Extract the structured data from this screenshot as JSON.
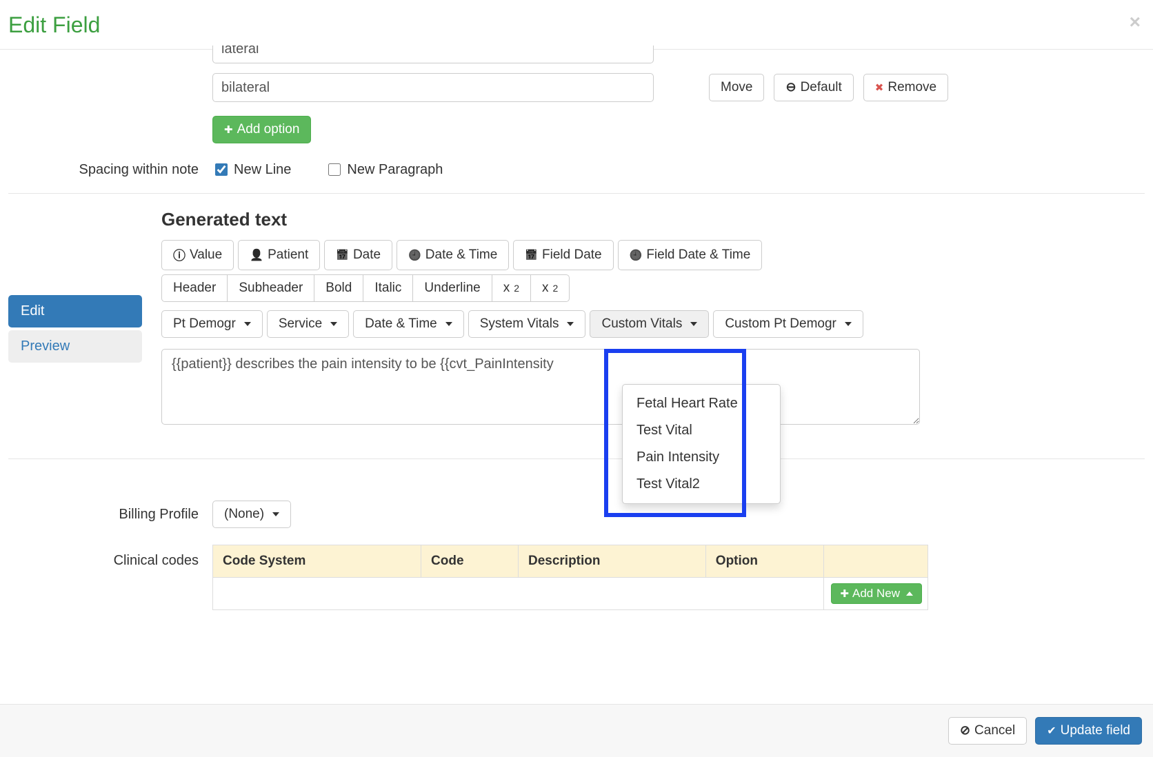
{
  "header": {
    "title": "Edit Field"
  },
  "options": {
    "row0_value": "lateral",
    "row1_value": "bilateral",
    "move_label": "Move",
    "default_label": "Default",
    "remove_label": "Remove",
    "add_option_label": "Add option"
  },
  "spacing": {
    "label": "Spacing within note",
    "newline_label": "New Line",
    "newparagraph_label": "New Paragraph",
    "newline_checked": true,
    "newparagraph_checked": false
  },
  "tabs": {
    "edit": "Edit",
    "preview": "Preview"
  },
  "generated": {
    "title": "Generated text",
    "toolbar": {
      "value": "Value",
      "patient": "Patient",
      "date": "Date",
      "datetime": "Date & Time",
      "fielddate": "Field Date",
      "fielddatetime": "Field Date & Time",
      "header": "Header",
      "subheader": "Subheader",
      "bold": "Bold",
      "italic": "Italic",
      "underline": "Underline",
      "sub": "x",
      "sup": "x",
      "ptdemogr": "Pt Demogr",
      "service": "Service",
      "datetime2": "Date & Time",
      "sysvitals": "System Vitals",
      "customvitals": "Custom Vitals",
      "customptdemogr": "Custom Pt Demogr"
    },
    "textarea_value": "{{patient}} describes the pain intensity to be {{cvt_PainIntensity",
    "custom_vitals_menu": [
      "Fetal Heart Rate",
      "Test Vital",
      "Pain Intensity",
      "Test Vital2"
    ]
  },
  "billing": {
    "label": "Billing Profile",
    "value": "(None)"
  },
  "codes": {
    "label": "Clinical codes",
    "headers": {
      "codesystem": "Code System",
      "code": "Code",
      "description": "Description",
      "option": "Option"
    },
    "addnew": "Add New"
  },
  "footer": {
    "cancel": "Cancel",
    "update": "Update field"
  }
}
